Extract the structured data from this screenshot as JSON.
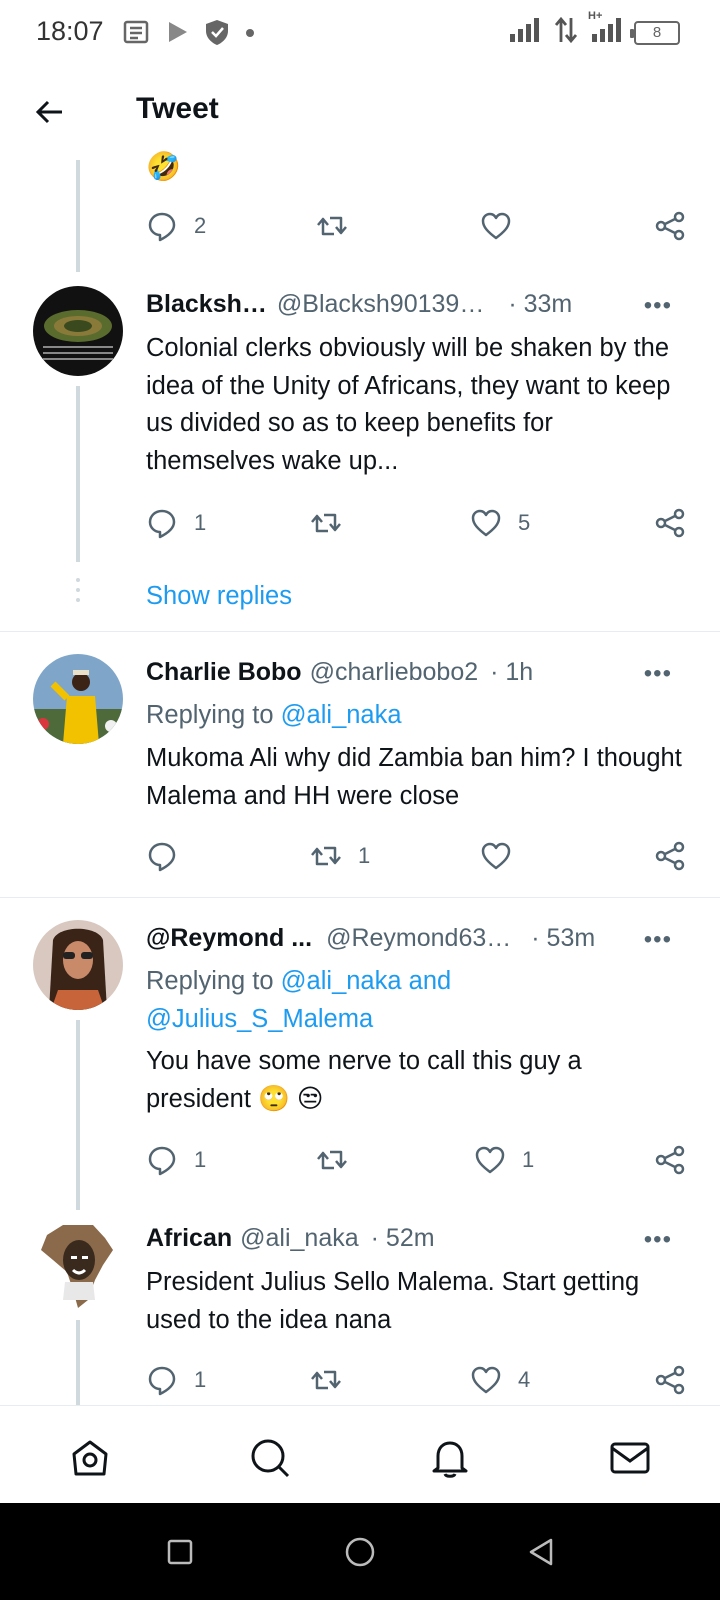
{
  "status_bar": {
    "time": "18:07",
    "battery": "8",
    "network": "H+",
    "icons_left": [
      "news-icon",
      "play-store-icon",
      "shield-icon",
      "dot-icon"
    ],
    "icons_right": [
      "signal-icon",
      "data-arrows-icon",
      "signal-h-plus-icon",
      "battery-icon"
    ]
  },
  "header": {
    "title": "Tweet",
    "back_icon": "arrow-left-icon"
  },
  "top_fragment": {
    "emoji": "🤣",
    "reply_count": "2",
    "retweet_count": "",
    "like_count": ""
  },
  "tweets": [
    {
      "name": "Blacksh…",
      "handle": "@Blacksh90139…",
      "time": "· 33m",
      "replying_to": "",
      "text": "Colonial clerks obviously will be shaken by the idea of the Unity of Africans, they want to keep us divided so as to keep benefits for themselves wake up...",
      "reply_count": "1",
      "retweet_count": "",
      "like_count": "5"
    },
    {
      "name": "Charlie Bobo",
      "handle": "@charliebobo2",
      "time": "· 1h",
      "replying_prefix": "Replying to ",
      "replying_to": "@ali_naka",
      "text": "Mukoma Ali why did Zambia ban him? I thought Malema and HH were close",
      "reply_count": "",
      "retweet_count": "1",
      "like_count": ""
    },
    {
      "name": "@Reymond ...",
      "handle": "@Reymond63…",
      "time": "· 53m",
      "replying_prefix": "Replying to ",
      "replying_to": "@ali_naka and",
      "replying_to_line2": "@Julius_S_Malema",
      "text": "You have some nerve to call this guy a president 🙄 😒",
      "reply_count": "1",
      "retweet_count": "",
      "like_count": "1"
    },
    {
      "name": "African",
      "handle": "@ali_naka",
      "time": "· 52m",
      "replying_to": "",
      "text": "President Julius Sello Malema. Start getting used to the idea nana",
      "reply_count": "1",
      "retweet_count": "",
      "like_count": "4"
    }
  ],
  "show_replies": "Show replies",
  "more": "•••",
  "colors": {
    "accent": "#1d9bf0",
    "text": "#0f1419",
    "muted": "#536471",
    "thread_line": "#cfd9de"
  },
  "bottom_nav": [
    "home-icon",
    "search-icon",
    "notifications-icon",
    "messages-icon"
  ],
  "system_nav": [
    "recent-apps-icon",
    "home-circle-icon",
    "back-triangle-icon"
  ]
}
